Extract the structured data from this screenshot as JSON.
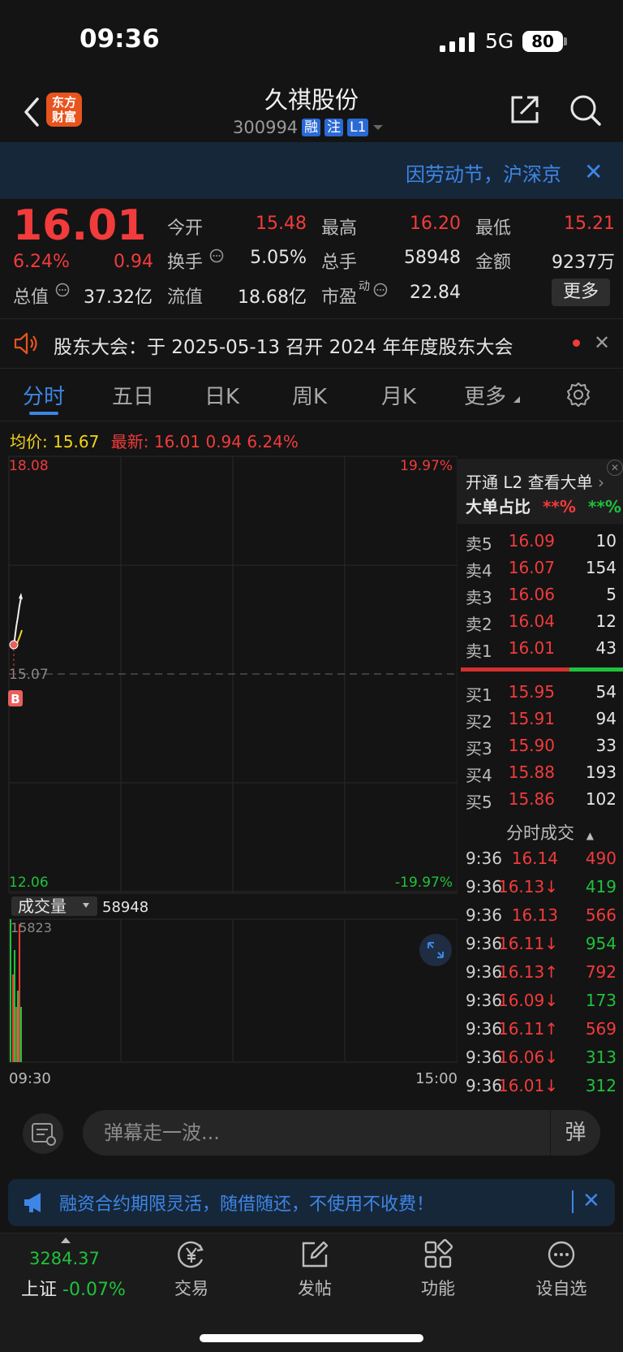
{
  "status_bar": {
    "time": "09:36",
    "network": "5G",
    "battery": "80"
  },
  "header": {
    "logo_line1": "东方",
    "logo_line2": "财富",
    "stock_name": "久祺股份",
    "stock_code": "300994",
    "tags": [
      "融",
      "注",
      "L1"
    ]
  },
  "notice": {
    "text": "因劳动节，沪深京"
  },
  "quote": {
    "price": "16.01",
    "change_pct": "6.24%",
    "change": "0.94",
    "fields": [
      {
        "label": "今开",
        "value": "15.48",
        "color": "red"
      },
      {
        "label": "最高",
        "value": "16.20",
        "color": "red"
      },
      {
        "label": "最低",
        "value": "15.21",
        "color": "red"
      },
      {
        "label": "换手",
        "value": "5.05%",
        "color": "white"
      },
      {
        "label": "总手",
        "value": "58948",
        "color": "white"
      },
      {
        "label": "金额",
        "value": "9237万",
        "color": "white"
      },
      {
        "label": "总值",
        "value": "37.32亿",
        "color": "white"
      },
      {
        "label": "流值",
        "value": "18.68亿",
        "color": "white"
      },
      {
        "label": "市盈",
        "value": "22.84",
        "color": "white"
      }
    ],
    "pe_sup": "动",
    "more_label": "更多"
  },
  "meeting": {
    "text": "股东大会：于 2025-05-13 召开 2024 年年度股东大会"
  },
  "tabs": [
    "分时",
    "五日",
    "日K",
    "周K",
    "月K",
    "更多"
  ],
  "avg_row": {
    "avg_label": "均价:",
    "avg_value": "15.67",
    "latest_label": "最新:",
    "latest_value": "16.01",
    "latest_change": "0.94",
    "latest_pct": "6.24%"
  },
  "chart": {
    "y_top": "18.08",
    "y_mid": "15.07",
    "y_bottom": "12.06",
    "pct_top": "19.97%",
    "pct_bottom": "-19.97%",
    "volume_label": "成交量",
    "volume_total": "58948",
    "volume_max": "15823",
    "time_start": "09:30",
    "time_end": "15:00",
    "b_marker": "B"
  },
  "order_book": {
    "title": "开通 L2 查看大单",
    "ratio_label": "大单占比",
    "ratio_red": "**%",
    "ratio_green": "**%",
    "asks": [
      {
        "label": "卖5",
        "price": "16.09",
        "volume": "10"
      },
      {
        "label": "卖4",
        "price": "16.07",
        "volume": "154"
      },
      {
        "label": "卖3",
        "price": "16.06",
        "volume": "5"
      },
      {
        "label": "卖2",
        "price": "16.04",
        "volume": "12"
      },
      {
        "label": "卖1",
        "price": "16.01",
        "volume": "43"
      }
    ],
    "bids": [
      {
        "label": "买1",
        "price": "15.95",
        "volume": "54"
      },
      {
        "label": "买2",
        "price": "15.91",
        "volume": "94"
      },
      {
        "label": "买3",
        "price": "15.90",
        "volume": "33"
      },
      {
        "label": "买4",
        "price": "15.88",
        "volume": "193"
      },
      {
        "label": "买5",
        "price": "15.86",
        "volume": "102"
      }
    ],
    "trades_title": "分时成交",
    "trades": [
      {
        "time": "9:36",
        "price": "16.14",
        "volume": "490",
        "vcolor": "red"
      },
      {
        "time": "9:36",
        "price": "16.13↓",
        "volume": "419",
        "vcolor": "green"
      },
      {
        "time": "9:36",
        "price": "16.13",
        "volume": "566",
        "vcolor": "red"
      },
      {
        "time": "9:36",
        "price": "16.11↓",
        "volume": "954",
        "vcolor": "green"
      },
      {
        "time": "9:36",
        "price": "16.13↑",
        "volume": "792",
        "vcolor": "red"
      },
      {
        "time": "9:36",
        "price": "16.09↓",
        "volume": "173",
        "vcolor": "green"
      },
      {
        "time": "9:36",
        "price": "16.11↑",
        "volume": "569",
        "vcolor": "red"
      },
      {
        "time": "9:36",
        "price": "16.06↓",
        "volume": "313",
        "vcolor": "green"
      },
      {
        "time": "9:36",
        "price": "16.01↓",
        "volume": "312",
        "vcolor": "green"
      }
    ]
  },
  "danmu": {
    "placeholder": "弹幕走一波...",
    "send_label": "弹"
  },
  "promo": {
    "text": "融资合约期限灵活，随借随还，不使用不收费！"
  },
  "bottom_nav": {
    "index_value": "3284.37",
    "index_name": "上证",
    "index_change": "-0.07%",
    "items": [
      "交易",
      "发帖",
      "功能",
      "设自选"
    ]
  },
  "colors": {
    "up": "#f23b3b",
    "down": "#1fc23c",
    "accent": "#3d86e6",
    "avg_line": "#f2d21c"
  }
}
